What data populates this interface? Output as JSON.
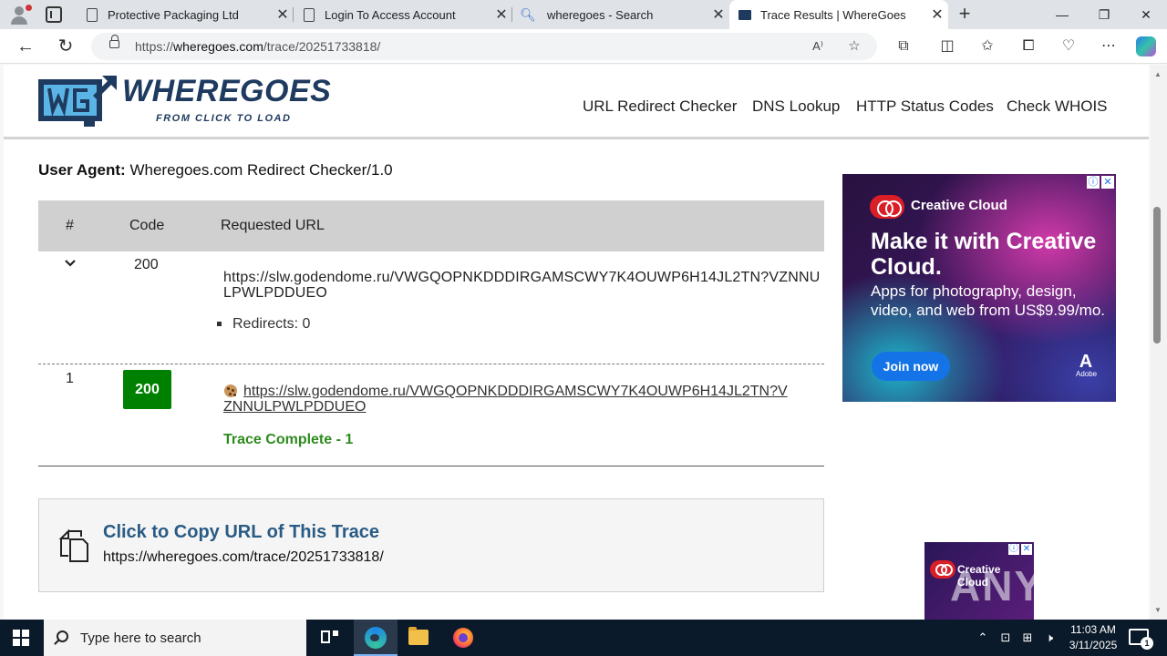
{
  "browser": {
    "tabs": [
      {
        "title": "Protective Packaging Ltd",
        "icon": "page-icon"
      },
      {
        "title": "Login To Access Account",
        "icon": "page-icon"
      },
      {
        "title": "wheregoes - Search",
        "icon": "search-icon"
      },
      {
        "title": "Trace Results | WhereGoes",
        "icon": "wheregoes-icon",
        "active": true
      }
    ],
    "address": {
      "scheme": "https://",
      "host": "wheregoes.com",
      "path": "/trace/20251733818/"
    }
  },
  "site": {
    "logo_title": "WHEREGOES",
    "logo_tagline": "FROM CLICK TO LOAD",
    "nav": [
      "URL Redirect Checker",
      "DNS Lookup",
      "HTTP Status Codes",
      "Check WHOIS"
    ]
  },
  "trace": {
    "user_agent_label": "User Agent:",
    "user_agent": "Wheregoes.com Redirect Checker/1.0",
    "headers": {
      "num": "#",
      "code": "Code",
      "url": "Requested URL"
    },
    "summary": {
      "code": "200",
      "url": "https://slw.godendome.ru/VWGQOPNKDDDIRGAMSCWY7K4OUWP6H14JL2TN?VZNNULPWLPDDUEO",
      "redirects": "Redirects: 0"
    },
    "hops": [
      {
        "num": "1",
        "code": "200",
        "url": "https://slw.godendome.ru/VWGQOPNKDDDIRGAMSCWY7K4OUWP6H14JL2TN?VZNNULPWLPDDUEO"
      }
    ],
    "complete_text": "Trace Complete - 1"
  },
  "copy": {
    "title": "Click to Copy URL of This Trace",
    "url": "https://wheregoes.com/trace/20251733818/"
  },
  "ads": {
    "main": {
      "brand": "Creative Cloud",
      "headline": "Make it with Creative Cloud.",
      "body": "Apps for photography, design, video, and web from US$9.99/mo.",
      "cta": "Join now",
      "adobe_wordmark": "Adobe"
    },
    "small": {
      "brand": "Creative Cloud"
    }
  },
  "watermark": "ANY.RUN",
  "taskbar": {
    "search_placeholder": "Type here to search",
    "time": "11:03 AM",
    "date": "3/11/2025",
    "notifications": "1"
  },
  "colors": {
    "brand": "#1e3a5f",
    "status_ok": "#008000",
    "complete": "#2e8b1e",
    "copy_title": "#2a5b85"
  }
}
